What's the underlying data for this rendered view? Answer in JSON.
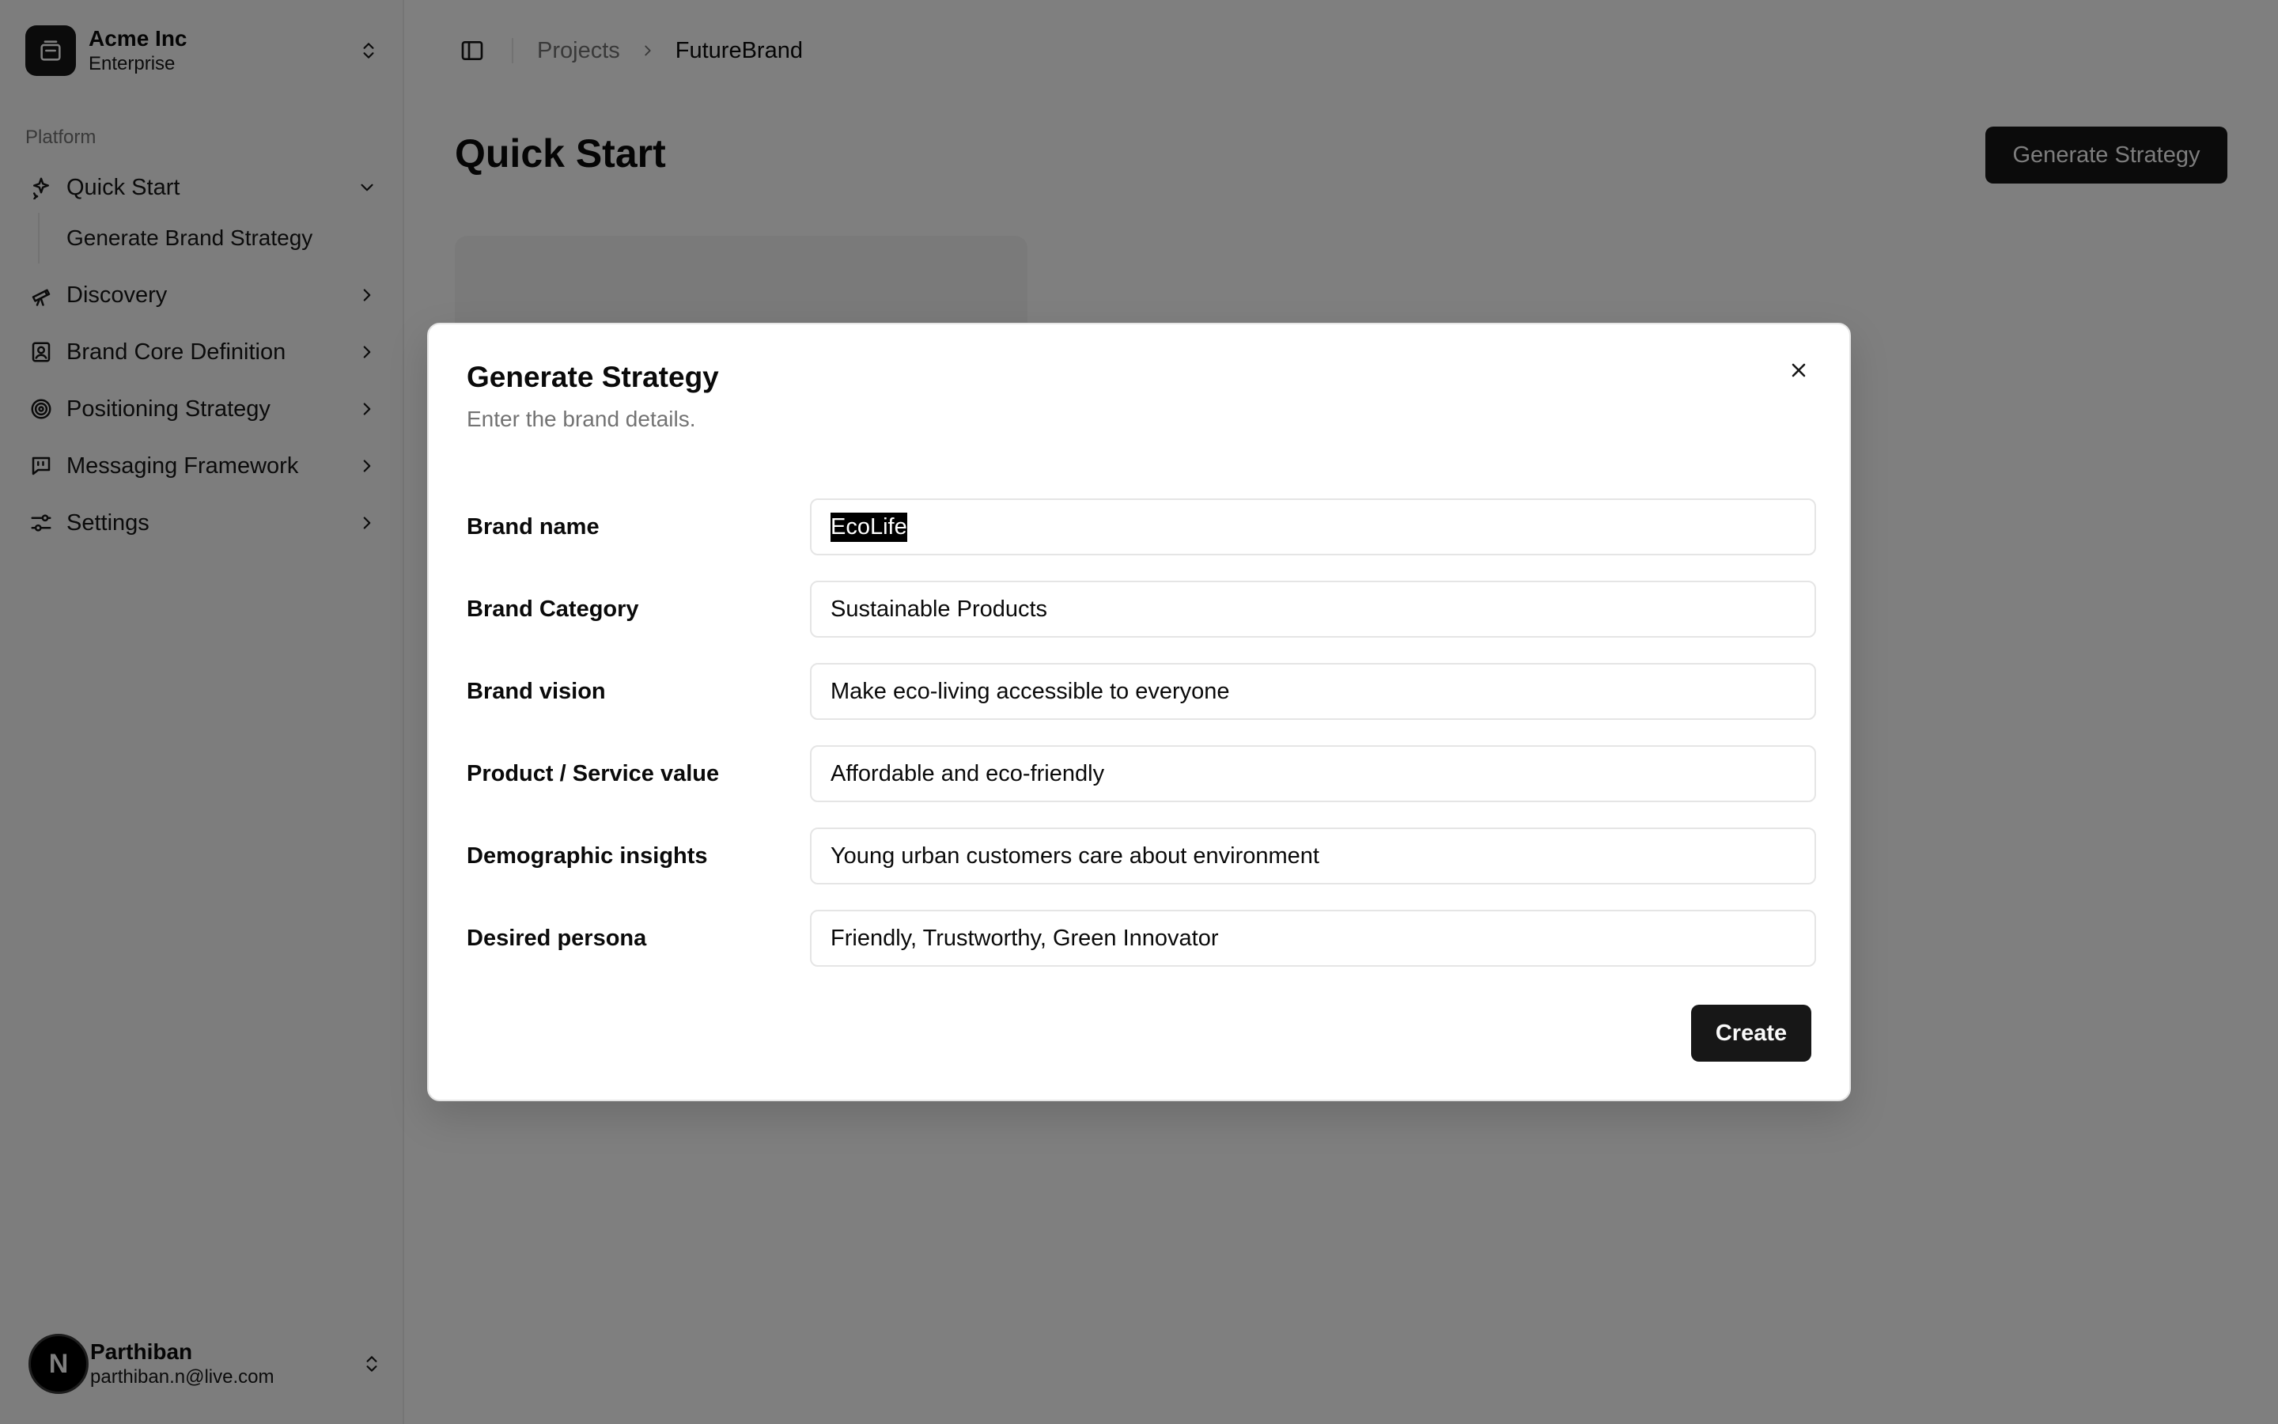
{
  "team": {
    "name": "Acme Inc",
    "plan": "Enterprise"
  },
  "sidebar": {
    "group_label": "Platform",
    "items": [
      {
        "label": "Quick Start",
        "icon": "sparkles-icon",
        "expanded": true,
        "subitems": [
          {
            "label": "Generate Brand Strategy"
          }
        ]
      },
      {
        "label": "Discovery",
        "icon": "telescope-icon"
      },
      {
        "label": "Brand Core Definition",
        "icon": "contact-icon"
      },
      {
        "label": "Positioning Strategy",
        "icon": "target-icon"
      },
      {
        "label": "Messaging Framework",
        "icon": "message-square-quote-icon"
      },
      {
        "label": "Settings",
        "icon": "sliders-icon"
      }
    ]
  },
  "user": {
    "initial": "N",
    "name": "Parthiban",
    "email": "parthiban.n@live.com"
  },
  "breadcrumb": {
    "parent": "Projects",
    "current": "FutureBrand"
  },
  "page": {
    "title": "Quick Start",
    "action_label": "Generate Strategy"
  },
  "dialog": {
    "title": "Generate Strategy",
    "description": "Enter the brand details.",
    "fields": [
      {
        "label": "Brand name",
        "value": "EcoLife",
        "selected": true
      },
      {
        "label": "Brand Category",
        "value": "Sustainable Products"
      },
      {
        "label": "Brand vision",
        "value": "Make eco-living accessible to everyone"
      },
      {
        "label": "Product / Service value",
        "value": "Affordable and eco-friendly"
      },
      {
        "label": "Demographic insights",
        "value": "Young urban customers care about environment"
      },
      {
        "label": "Desired persona",
        "value": "Friendly, Trustworthy, Green Innovator"
      }
    ],
    "submit_label": "Create"
  },
  "colors": {
    "primary": "#171717",
    "overlay": "rgba(0,0,0,0.5)",
    "muted_text": "#737373"
  }
}
